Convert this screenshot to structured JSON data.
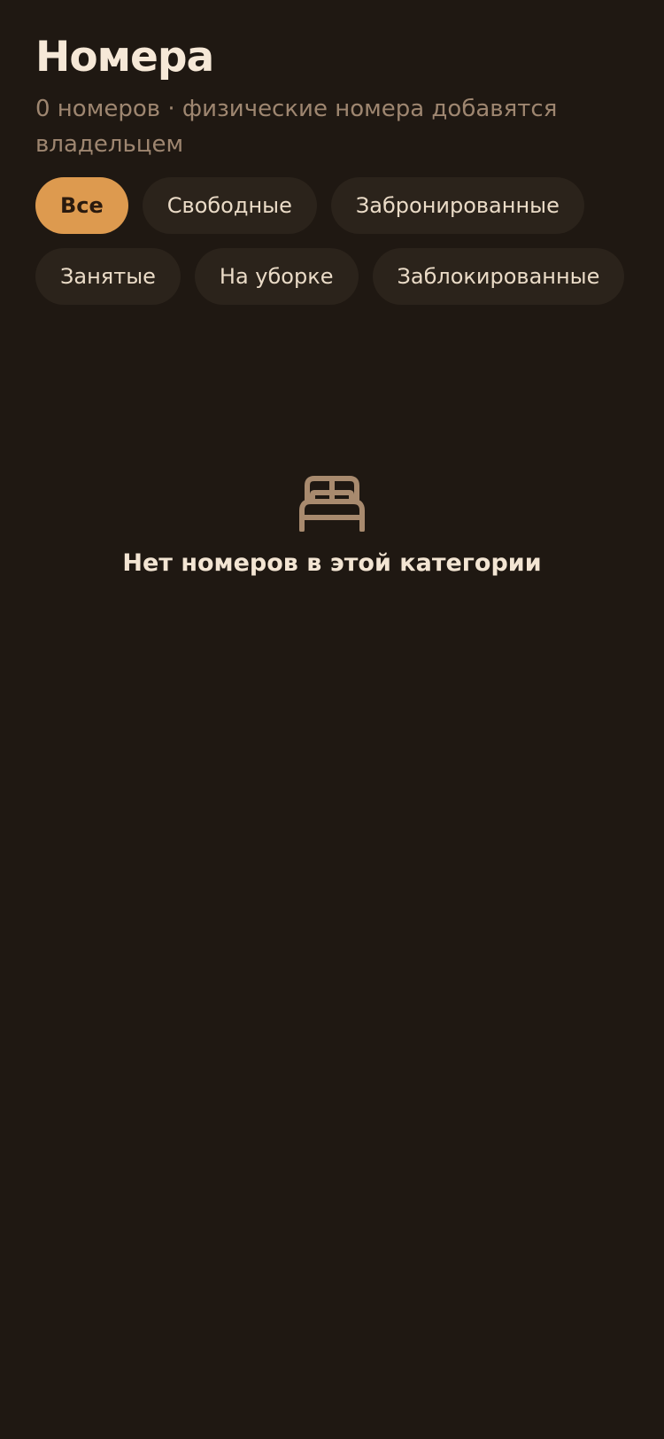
{
  "header": {
    "title": "Номера",
    "subtitle": "0 номеров · физические номера добавятся владельцем"
  },
  "filters": [
    {
      "label": "Все",
      "active": true
    },
    {
      "label": "Свободные",
      "active": false
    },
    {
      "label": "Забронированные",
      "active": false
    },
    {
      "label": "Занятые",
      "active": false
    },
    {
      "label": "На уборке",
      "active": false
    },
    {
      "label": "Заблокированные",
      "active": false
    }
  ],
  "empty_state": {
    "icon": "bed-icon",
    "message": "Нет номеров в этой категории"
  },
  "colors": {
    "background": "#1f1812",
    "accent": "#dd9a4f",
    "chip": "#2b231b",
    "title": "#f6e8d7",
    "muted": "#9e8670",
    "icon": "#a88a6e"
  }
}
